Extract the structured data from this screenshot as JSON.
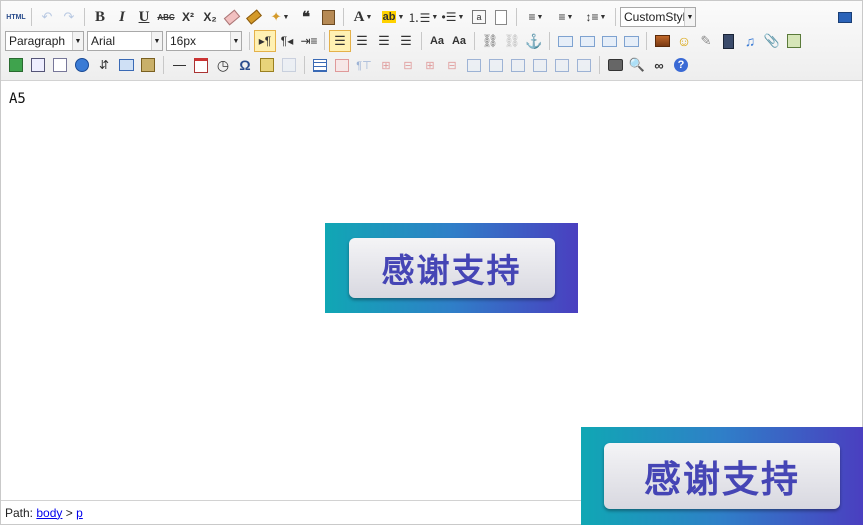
{
  "toolbar": {
    "html_label": "HTML",
    "bold": "B",
    "italic": "I",
    "underline": "U",
    "strike": "ABC",
    "sup": "X²",
    "sub": "X₂",
    "quote": "❝",
    "format_block": "Paragraph",
    "font_family": "Arial",
    "font_size": "16px",
    "custom_style": "CustomStyl",
    "forecolor": "A",
    "omega": "Ω",
    "help": "?"
  },
  "content": {
    "text": "A5",
    "banner_text": "感谢支持"
  },
  "statusbar": {
    "path_label": "Path:",
    "body": "body",
    "sep": ">",
    "p": "p"
  },
  "colors": {
    "active_bg": "#fff1b3",
    "banner_start": "#10a7b4",
    "banner_end": "#4a3fc0",
    "banner_text": "#4545b5",
    "link": "#0000ee"
  }
}
